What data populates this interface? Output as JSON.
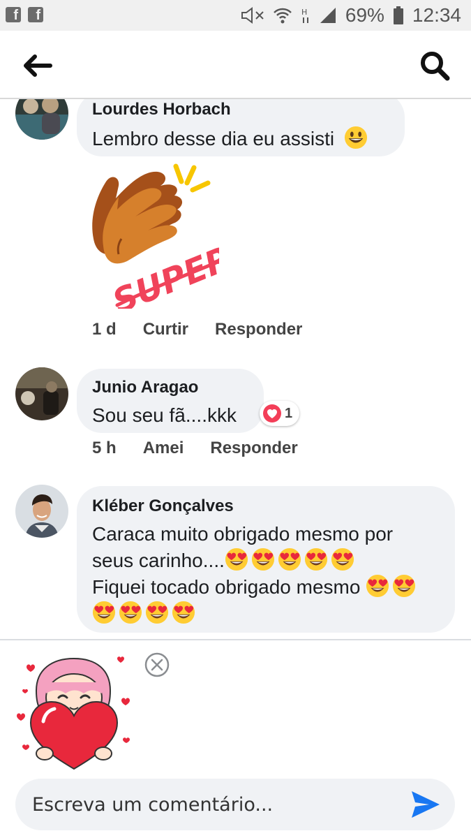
{
  "status_bar": {
    "battery": "69%",
    "time": "12:34"
  },
  "comments": [
    {
      "author": "Lourdes Horbach",
      "text": "Lembro desse dia eu assisti",
      "text_emoji": "grinning-face",
      "sticker_text": "SUPER!",
      "time": "1 d",
      "like_label": "Curtir",
      "reply_label": "Responder"
    },
    {
      "author": "Junio Aragao",
      "text": "Sou seu fã....kkk",
      "reaction": {
        "icon": "love-reaction-icon",
        "count": "1"
      },
      "time": "5 h",
      "like_label": "Amei",
      "reply_label": "Responder"
    },
    {
      "author": "Kléber Gonçalves",
      "line1": "Caraca muito obrigado mesmo por",
      "line2": "seus carinho....",
      "line2_emoji_count": 5,
      "line3": "Fiquei tocado obrigado mesmo",
      "line3_emoji_count": 2,
      "line4_emoji_count": 4,
      "emoji": "heart-eyes-face"
    }
  ],
  "composer": {
    "sticker": "girl-holding-heart-sticker",
    "placeholder": "Escreva um comentário..."
  },
  "colors": {
    "accent": "#1877f2",
    "bubble": "#f0f2f5",
    "love": "#f33e58"
  }
}
